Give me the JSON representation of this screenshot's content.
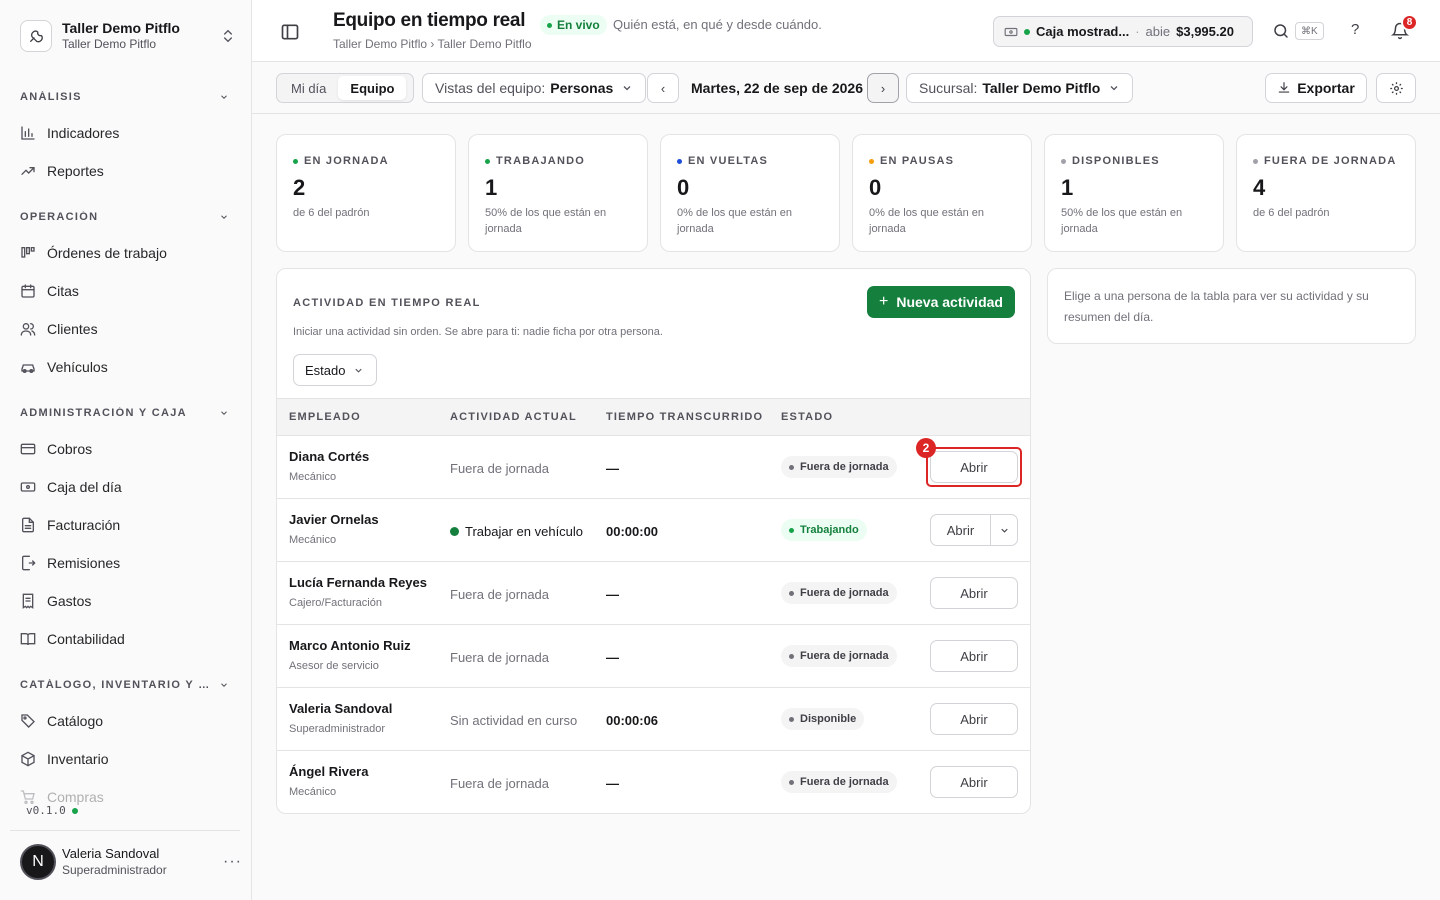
{
  "sidebar": {
    "brand": {
      "name": "Taller Demo Pitflo",
      "subtitle": "Taller Demo Pitflo",
      "icon": "wrench-icon"
    },
    "sections": [
      {
        "title": "Análisis",
        "items": [
          {
            "label": "Indicadores",
            "icon": "bar-chart-icon"
          },
          {
            "label": "Reportes",
            "icon": "trending-up-icon"
          }
        ]
      },
      {
        "title": "Operación",
        "items": [
          {
            "label": "Órdenes de trabajo",
            "icon": "kanban-icon"
          },
          {
            "label": "Citas",
            "icon": "calendar-icon"
          },
          {
            "label": "Clientes",
            "icon": "users-icon"
          },
          {
            "label": "Vehículos",
            "icon": "car-icon"
          }
        ]
      },
      {
        "title": "Administración y caja",
        "items": [
          {
            "label": "Cobros",
            "icon": "credit-card-icon"
          },
          {
            "label": "Caja del día",
            "icon": "banknote-icon"
          },
          {
            "label": "Facturación",
            "icon": "file-text-icon"
          },
          {
            "label": "Remisiones",
            "icon": "file-export-icon"
          },
          {
            "label": "Gastos",
            "icon": "receipt-icon"
          },
          {
            "label": "Contabilidad",
            "icon": "book-open-icon"
          }
        ]
      },
      {
        "title": "Catálogo, inventario y co...",
        "items": [
          {
            "label": "Catálogo",
            "icon": "tags-icon"
          },
          {
            "label": "Inventario",
            "icon": "package-icon"
          },
          {
            "label": "Compras",
            "icon": "cart-icon"
          }
        ]
      }
    ],
    "version": "v0.1.0",
    "user": {
      "initial": "N",
      "name": "Valeria Sandoval",
      "role": "Superadministrador",
      "more": "···"
    }
  },
  "header": {
    "title": "Equipo en tiempo real",
    "live_badge": "En vivo",
    "subtitle": "Quién está, en qué y desde cuándo.",
    "breadcrumb": "Taller Demo Pitflo › Taller Demo Pitflo",
    "cash": {
      "name": "Caja mostrad...",
      "separator": "·",
      "status": "abie",
      "amount": "$3,995.20"
    },
    "shortcut": "⌘K",
    "help": "?",
    "notifications": "8"
  },
  "toolbar": {
    "tabs": [
      "Mi día",
      "Equipo"
    ],
    "active_tab": 1,
    "view_label": "Vistas del equipo:",
    "view_value": "Personas",
    "prev": "‹",
    "date": "Martes, 22 de sep de 2026",
    "next": "›",
    "branch_label": "Sucursal:",
    "branch_value": "Taller Demo Pitflo",
    "export": "Exportar"
  },
  "stats": [
    {
      "label": "En jornada",
      "value": "2",
      "sub": "de 6 del padrón",
      "color": "#16a34a"
    },
    {
      "label": "Trabajando",
      "value": "1",
      "sub": "50% de los que están en jornada",
      "color": "#16a34a"
    },
    {
      "label": "En vueltas",
      "value": "0",
      "sub": "0% de los que están en jornada",
      "color": "#1d4ed8"
    },
    {
      "label": "En pausas",
      "value": "0",
      "sub": "0% de los que están en jornada",
      "color": "#f59e0b"
    },
    {
      "label": "Disponibles",
      "value": "1",
      "sub": "50% de los que están en jornada",
      "color": "#a1a1aa"
    },
    {
      "label": "Fuera de jornada",
      "value": "4",
      "sub": "de 6 del padrón",
      "color": "#a1a1aa"
    }
  ],
  "activity": {
    "title": "Actividad en tiempo real",
    "description": "Iniciar una actividad sin orden. Se abre para ti: nadie ficha por otra persona.",
    "new_button": "Nueva actividad",
    "filter": "Estado",
    "columns": [
      "Empleado",
      "Actividad actual",
      "Tiempo transcurrido",
      "Estado"
    ],
    "rows": [
      {
        "name": "Diana Cortés",
        "role": "Mecánico",
        "activity": "Fuera de jornada",
        "time": "—",
        "status": "Fuera de jornada",
        "action": "Abrir"
      },
      {
        "name": "Javier Ornelas",
        "role": "Mecánico",
        "activity": "Trabajar en vehículo",
        "time": "00:00:00",
        "status": "Trabajando",
        "action": "Abrir"
      },
      {
        "name": "Lucía Fernanda Reyes",
        "role": "Cajero/Facturación",
        "activity": "Fuera de jornada",
        "time": "—",
        "status": "Fuera de jornada",
        "action": "Abrir"
      },
      {
        "name": "Marco Antonio Ruiz",
        "role": "Asesor de servicio",
        "activity": "Fuera de jornada",
        "time": "—",
        "status": "Fuera de jornada",
        "action": "Abrir"
      },
      {
        "name": "Valeria Sandoval",
        "role": "Superadministrador",
        "activity": "Sin actividad en curso",
        "time": "00:00:06",
        "status": "Disponible",
        "action": "Abrir"
      },
      {
        "name": "Ángel Rivera",
        "role": "Mecánico",
        "activity": "Fuera de jornada",
        "time": "—",
        "status": "Fuera de jornada",
        "action": "Abrir"
      }
    ],
    "marker": "2"
  },
  "detail": {
    "empty_text": "Elige a una persona de la tabla para ver su actividad y su resumen del día."
  }
}
